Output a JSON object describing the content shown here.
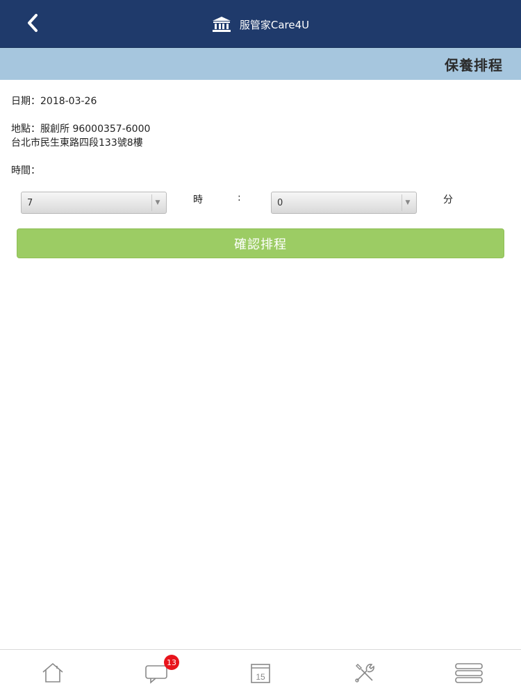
{
  "header": {
    "app_title": "服管家Care4U",
    "back_icon": "chevron-left-icon",
    "logo_icon": "bank-building-icon"
  },
  "subheader": {
    "title": "保養排程"
  },
  "details": {
    "date_label": "日期：2018-03-26",
    "location_label": "地點：服創所 96000357-6000",
    "address": "台北市民生東路四段133號8樓",
    "time_label": "時間："
  },
  "time_picker": {
    "hour_value": "7",
    "hour_unit": "時",
    "separator": ":",
    "minute_value": "0",
    "minute_unit": "分"
  },
  "actions": {
    "confirm_label": "確認排程"
  },
  "tabbar": {
    "items": [
      {
        "icon": "home-icon"
      },
      {
        "icon": "chat-icon",
        "badge": "13"
      },
      {
        "icon": "calendar-icon",
        "day": "15"
      },
      {
        "icon": "tools-icon"
      },
      {
        "icon": "menu-icon"
      }
    ]
  },
  "colors": {
    "header_bg": "#1f3a6b",
    "subheader_bg": "#a6c6de",
    "confirm_bg": "#9ccc64",
    "badge_bg": "#e8141c"
  }
}
